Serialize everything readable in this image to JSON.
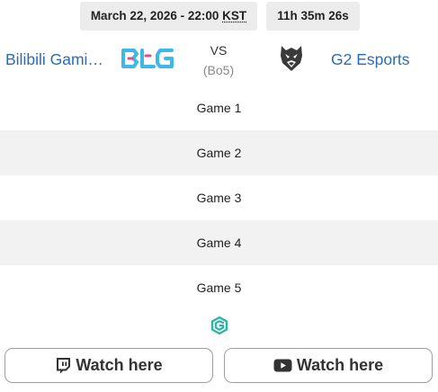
{
  "header": {
    "date_text": "March 22, 2026 - 22:00",
    "timezone": "KST",
    "countdown": "11h 35m 26s"
  },
  "teams": {
    "left": {
      "name": "Bilibili Gami…",
      "logo_icon": "bilibili-gaming-logo"
    },
    "right": {
      "name": "G2 Esports",
      "logo_icon": "g2-esports-logo"
    }
  },
  "versus": {
    "vs_label": "VS",
    "format": "(Bo5)"
  },
  "games": [
    {
      "label": "Game 1"
    },
    {
      "label": "Game 2"
    },
    {
      "label": "Game 3"
    },
    {
      "label": "Game 4"
    },
    {
      "label": "Game 5"
    }
  ],
  "source_icon": "gol-gg-icon",
  "streams": [
    {
      "label": "Watch here",
      "icon": "twitch-icon"
    },
    {
      "label": "Watch here",
      "icon": "youtube-icon"
    }
  ],
  "colors": {
    "team_link": "#2a6db5",
    "badge_bg": "#ececec",
    "alt_row_bg": "#f2f2f2",
    "bgl_logo": "#3fb8e8",
    "bgl_accent": "#e84a7a",
    "source_icon": "#2bb5a6"
  }
}
